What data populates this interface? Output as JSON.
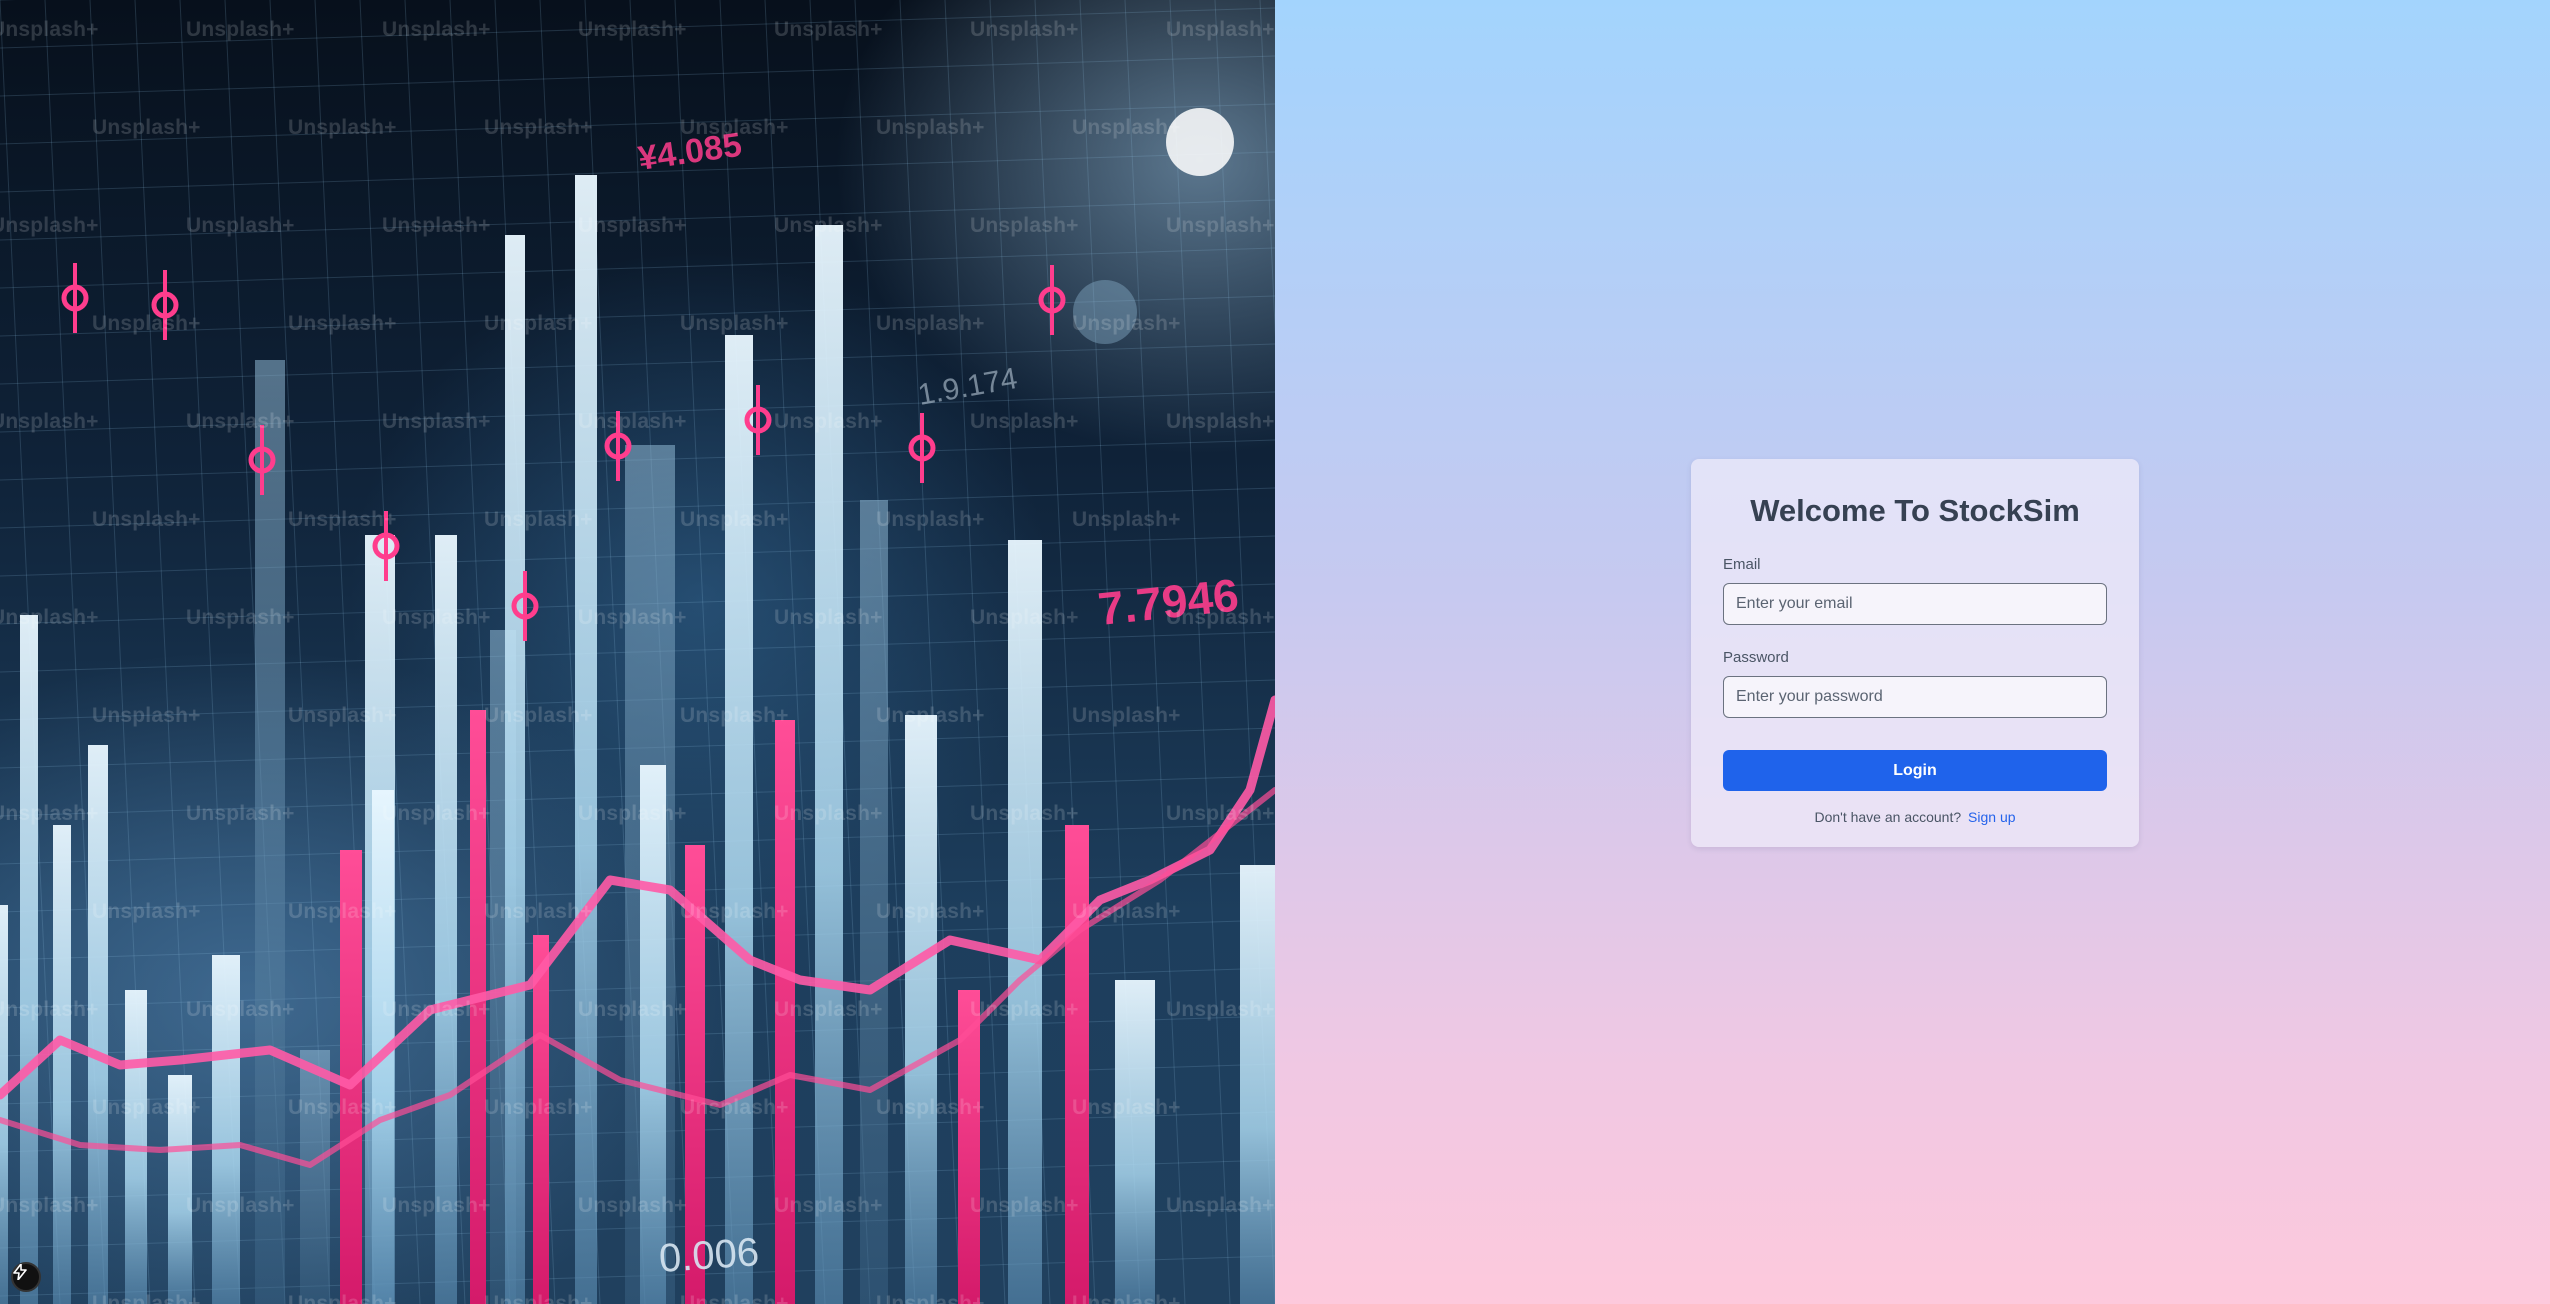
{
  "hero": {
    "watermark": "Unsplash+",
    "price_labels": [
      "¥4.085",
      "7.7946",
      "0.006",
      "1.9.174"
    ]
  },
  "auth": {
    "title": "Welcome To StockSim",
    "email_label": "Email",
    "email_placeholder": "Enter your email",
    "password_label": "Password",
    "password_placeholder": "Enter your password",
    "login_label": "Login",
    "signup_prompt": "Don't have an account?",
    "signup_link": "Sign up"
  },
  "colors": {
    "primary": "#1f63eb",
    "link": "#2563eb",
    "chart_pink": "#ff3d8d"
  },
  "icons": {
    "corner_badge": "lightning-icon"
  }
}
